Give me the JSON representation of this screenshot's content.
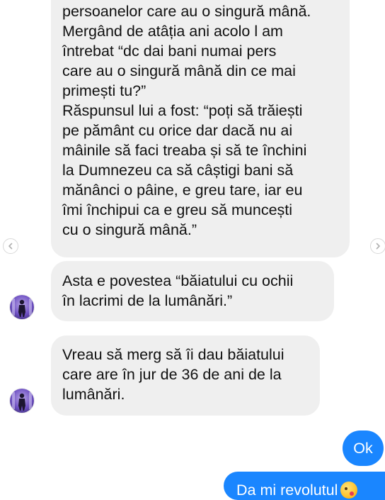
{
  "conversation": {
    "messages": [
      {
        "sender": "contact",
        "text": "persoanelor care au o singură mână.\nMergând de atâția ani acolo l am\nîntrebat “dc dai bani numai pers\ncare au o singură mână din ce mai\nprimești tu?”\nRăspunsul lui a fost: “poți să trăiești\npe pământ cu orice dar dacă nu ai\nmâinile să faci treaba și să te închini\nla Dumnezeu ca să câștigi bani să\nmănânci o pâine, e greu tare, iar eu\nîmi închipui  ca e greu să muncești\ncu o singură mână.”"
      },
      {
        "sender": "contact",
        "text": "Asta e povestea “băiatului cu ochii\nîn lacrimi de la lumânări.”"
      },
      {
        "sender": "contact",
        "text": "Vreau să merg să îi dau băiatului\ncare are în jur de 36 de ani de la\nlumânări."
      },
      {
        "sender": "me",
        "text": "Ok"
      },
      {
        "sender": "me",
        "text": "Da mi revolutul",
        "emoji": "kissing-face-emoji"
      }
    ]
  },
  "navigation": {
    "prev_icon": "chevron-left-icon",
    "next_icon": "chevron-right-icon"
  },
  "colors": {
    "incoming_bubble": "#efefef",
    "outgoing_bubble": "#1a86ff",
    "background": "#ffffff"
  }
}
